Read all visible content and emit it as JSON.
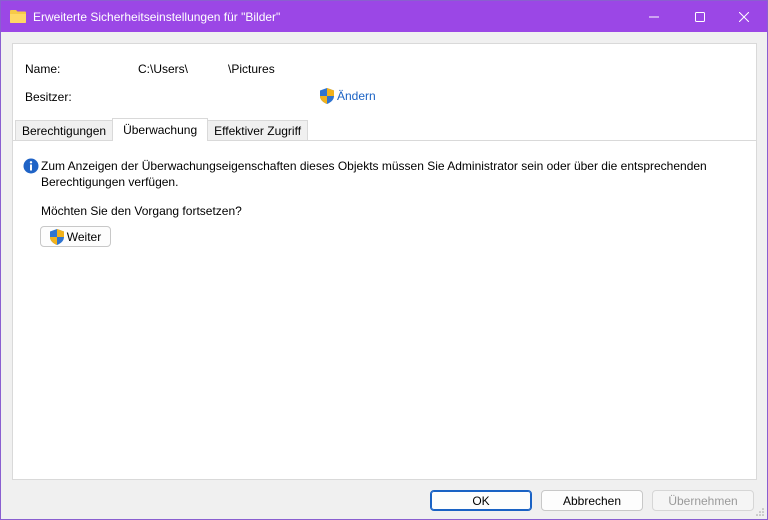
{
  "window": {
    "title": "Erweiterte Sicherheitseinstellungen für \"Bilder\""
  },
  "details": {
    "name_label": "Name:",
    "name_value": "C:\\Users\\            \\Pictures",
    "owner_label": "Besitzer:",
    "change_label": "Ändern"
  },
  "tabs": [
    {
      "label": "Berechtigungen",
      "active": false
    },
    {
      "label": "Überwachung",
      "active": true
    },
    {
      "label": "Effektiver Zugriff",
      "active": false
    }
  ],
  "auditing": {
    "info_text": "Zum Anzeigen der Überwachungseigenschaften dieses Objekts müssen Sie Administrator sein oder über die entsprechenden Berechtigungen verfügen.",
    "question": "Möchten Sie den Vorgang fortsetzen?",
    "continue_label": "Weiter"
  },
  "footer": {
    "ok_label": "OK",
    "cancel_label": "Abbrechen",
    "apply_label": "Übernehmen",
    "apply_enabled": false
  },
  "icons": {
    "title": "folder-icon",
    "minimize": "minimize-icon",
    "maximize": "maximize-icon",
    "close": "close-icon",
    "uac": "uac-shield-icon",
    "info": "info-icon"
  },
  "colors": {
    "titlebar": "#9b47e6",
    "link": "#1a62c4",
    "default_button_border": "#1a62c4",
    "info_icon": "#1f63c6"
  }
}
